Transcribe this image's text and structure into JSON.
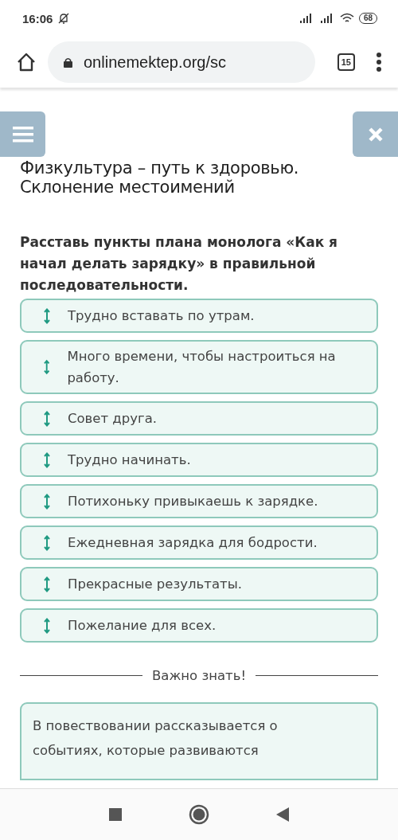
{
  "status_bar": {
    "time": "16:06",
    "battery": "68"
  },
  "browser": {
    "url": "onlinemektep.org/sc",
    "tab_count": "15"
  },
  "lesson_title": "Физкультура – путь к здоровью. Склонение местоимений",
  "question": "Расставь пункты плана монолога «Как я начал делать зарядку» в правильной последовательности.",
  "items": [
    {
      "text": "Трудно вставать по утрам."
    },
    {
      "text": "Много времени, чтобы настроиться на работу."
    },
    {
      "text": "Совет друга."
    },
    {
      "text": "Трудно начинать."
    },
    {
      "text": "Потихоньку привыкаешь к зарядке."
    },
    {
      "text": "Ежедневная зарядка для бодрости."
    },
    {
      "text": "Прекрасные результаты."
    },
    {
      "text": "Пожелание для всех."
    }
  ],
  "divider_label": "Важно знать!",
  "info": {
    "lines": [
      "В повествовании рассказывается о",
      "событиях, которые развиваются"
    ]
  }
}
